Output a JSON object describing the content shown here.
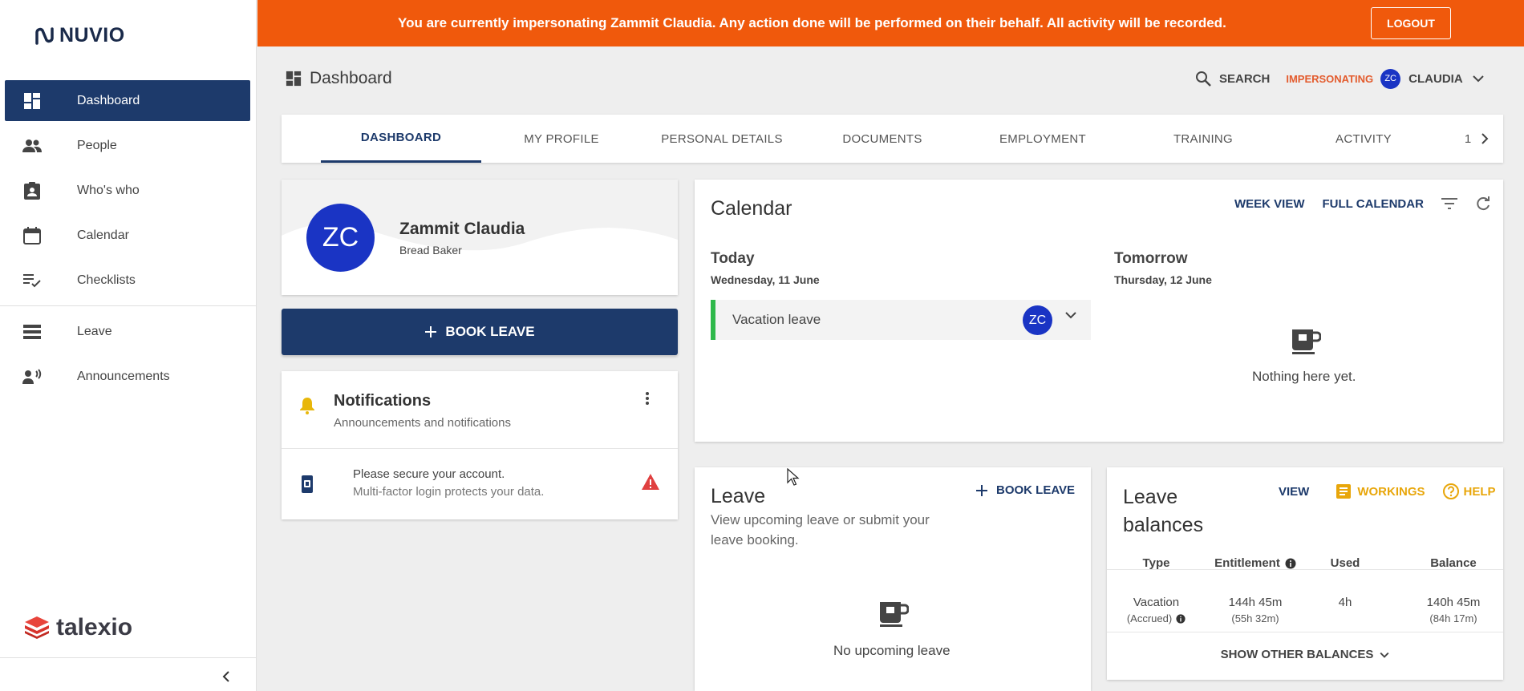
{
  "sidebar": {
    "brand": "NUVIO",
    "items": [
      {
        "label": "Dashboard",
        "icon": "dashboard-icon"
      },
      {
        "label": "People",
        "icon": "people-icon"
      },
      {
        "label": "Who's who",
        "icon": "badge-icon"
      },
      {
        "label": "Calendar",
        "icon": "calendar-icon"
      },
      {
        "label": "Checklists",
        "icon": "checklist-icon"
      },
      {
        "label": "Leave",
        "icon": "leave-icon"
      },
      {
        "label": "Announcements",
        "icon": "announcement-icon"
      }
    ],
    "footer_brand": "talexio"
  },
  "banner": {
    "message": "You are currently impersonating Zammit Claudia. Any action done will be performed on their behalf. All activity will be recorded.",
    "logout_label": "LOGOUT",
    "color": "#f0590c"
  },
  "header": {
    "title": "Dashboard",
    "search_label": "SEARCH",
    "impersonating_label": "IMPERSONATING",
    "user_initials": "ZC",
    "user_name": "CLAUDIA"
  },
  "tabs": [
    {
      "label": "DASHBOARD",
      "active": true
    },
    {
      "label": "MY PROFILE"
    },
    {
      "label": "PERSONAL DETAILS"
    },
    {
      "label": "DOCUMENTS"
    },
    {
      "label": "EMPLOYMENT"
    },
    {
      "label": "TRAINING"
    },
    {
      "label": "ACTIVITY"
    }
  ],
  "tabs_more": "1",
  "profile": {
    "initials": "ZC",
    "name": "Zammit Claudia",
    "role": "Bread Baker"
  },
  "book_leave_label": "BOOK LEAVE",
  "notifications": {
    "title": "Notifications",
    "subtitle": "Announcements and notifications",
    "items": [
      {
        "line1": "Please secure your account.",
        "line2": "Multi-factor login protects your data."
      }
    ]
  },
  "calendar": {
    "title": "Calendar",
    "week_view": "WEEK VIEW",
    "full_calendar": "FULL CALENDAR",
    "today": {
      "label": "Today",
      "date": "Wednesday, 11 June",
      "events": [
        {
          "label": "Vacation leave",
          "initials": "ZC",
          "color": "#2eb84a"
        }
      ]
    },
    "tomorrow": {
      "label": "Tomorrow",
      "date": "Thursday, 12 June",
      "empty": "Nothing here yet."
    }
  },
  "leave": {
    "title": "Leave",
    "subtitle": "View upcoming leave or submit your leave booking.",
    "book_label": "BOOK LEAVE",
    "empty": "No upcoming leave"
  },
  "balances": {
    "title": "Leave balances",
    "view_label": "VIEW",
    "workings_label": "WORKINGS",
    "help_label": "HELP",
    "columns": [
      "Type",
      "Entitlement",
      "Used",
      "Balance"
    ],
    "rows": [
      {
        "type": "Vacation",
        "type_sub": "(Accrued)",
        "entitlement": "144h 45m",
        "entitlement_sub": "(55h 32m)",
        "used": "4h",
        "balance": "140h 45m",
        "balance_sub": "(84h 17m)"
      }
    ],
    "show_more": "SHOW OTHER BALANCES"
  }
}
